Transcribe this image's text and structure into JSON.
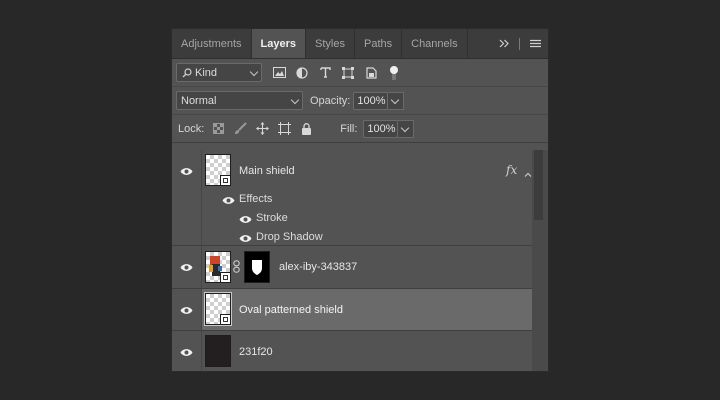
{
  "tabs": [
    {
      "label": "Adjustments",
      "active": false
    },
    {
      "label": "Layers",
      "active": true
    },
    {
      "label": "Styles",
      "active": false
    },
    {
      "label": "Paths",
      "active": false
    },
    {
      "label": "Channels",
      "active": false
    }
  ],
  "filter": {
    "kind_label": "Kind",
    "icons": [
      "pixel-layer-filter-icon",
      "adjustment-layer-filter-icon",
      "type-layer-filter-icon",
      "shape-layer-filter-icon",
      "smart-object-filter-icon",
      "filter-toggle-icon"
    ]
  },
  "blend": {
    "mode": "Normal",
    "opacity_label": "Opacity:",
    "opacity_value": "100%"
  },
  "lock": {
    "label": "Lock:",
    "icons": [
      "lock-transparent-pixels-icon",
      "lock-image-pixels-icon",
      "lock-position-icon",
      "lock-artboard-icon",
      "lock-all-icon"
    ],
    "fill_label": "Fill:",
    "fill_value": "100%"
  },
  "layers": [
    {
      "name": "Main shield",
      "has_fx": true,
      "fx_label": "fx",
      "effects_label": "Effects",
      "effects": [
        "Stroke",
        "Drop Shadow"
      ]
    },
    {
      "name": "alex-iby-343837",
      "has_mask": true
    },
    {
      "name": "Oval patterned shield",
      "selected": true
    },
    {
      "name": "231f20",
      "fill_color": "#231f20"
    }
  ],
  "colors": {
    "panel_bg": "#535353",
    "tabbar_bg": "#3c3c3c",
    "selected_row": "#6a6a6a",
    "app_bg": "#282828"
  }
}
